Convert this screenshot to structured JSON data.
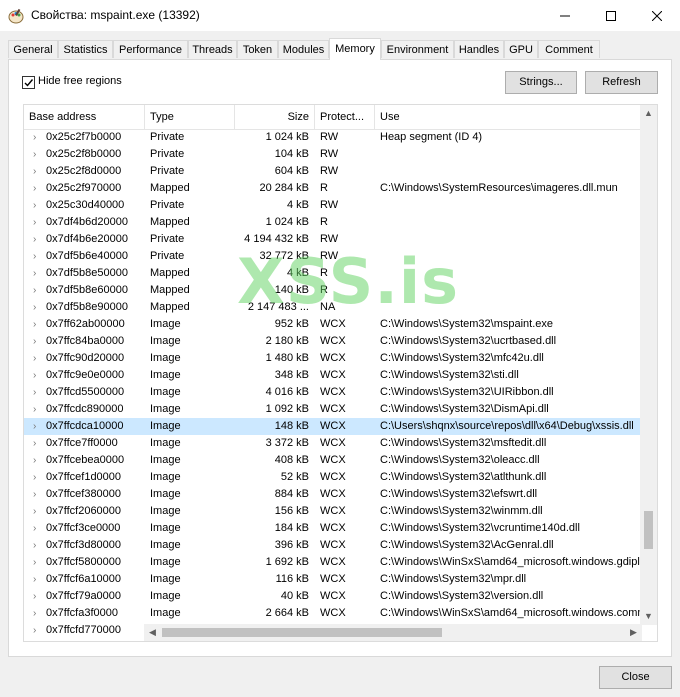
{
  "window": {
    "title": "Свойства: mspaint.exe (13392)",
    "minimize_glyph": "–",
    "maximize_glyph": "☐",
    "close_glyph": "✕"
  },
  "tabs": [
    {
      "label": "General"
    },
    {
      "label": "Statistics"
    },
    {
      "label": "Performance"
    },
    {
      "label": "Threads"
    },
    {
      "label": "Token"
    },
    {
      "label": "Modules"
    },
    {
      "label": "Memory",
      "active": true
    },
    {
      "label": "Environment"
    },
    {
      "label": "Handles"
    },
    {
      "label": "GPU"
    },
    {
      "label": "Comment"
    }
  ],
  "toolbar": {
    "hide_free_label": "Hide free regions",
    "hide_free_checked": true,
    "strings_label": "Strings...",
    "refresh_label": "Refresh"
  },
  "columns": [
    "Base address",
    "Type",
    "Size",
    "Protect...",
    "Use"
  ],
  "rows": [
    {
      "addr": "0x25c2f7b0000",
      "type": "Private",
      "size": "1 024 kB",
      "prot": "RW",
      "use": "Heap segment (ID 4)"
    },
    {
      "addr": "0x25c2f8b0000",
      "type": "Private",
      "size": "104 kB",
      "prot": "RW",
      "use": ""
    },
    {
      "addr": "0x25c2f8d0000",
      "type": "Private",
      "size": "604 kB",
      "prot": "RW",
      "use": ""
    },
    {
      "addr": "0x25c2f970000",
      "type": "Mapped",
      "size": "20 284 kB",
      "prot": "R",
      "use": "C:\\Windows\\SystemResources\\imageres.dll.mun"
    },
    {
      "addr": "0x25c30d40000",
      "type": "Private",
      "size": "4 kB",
      "prot": "RW",
      "use": ""
    },
    {
      "addr": "0x7df4b6d20000",
      "type": "Mapped",
      "size": "1 024 kB",
      "prot": "R",
      "use": ""
    },
    {
      "addr": "0x7df4b6e20000",
      "type": "Private",
      "size": "4 194 432 kB",
      "prot": "RW",
      "use": ""
    },
    {
      "addr": "0x7df5b6e40000",
      "type": "Private",
      "size": "32 772 kB",
      "prot": "RW",
      "use": ""
    },
    {
      "addr": "0x7df5b8e50000",
      "type": "Mapped",
      "size": "4 kB",
      "prot": "R",
      "use": ""
    },
    {
      "addr": "0x7df5b8e60000",
      "type": "Mapped",
      "size": "140 kB",
      "prot": "R",
      "use": ""
    },
    {
      "addr": "0x7df5b8e90000",
      "type": "Mapped",
      "size": "2 147 483 ...",
      "prot": "NA",
      "use": ""
    },
    {
      "addr": "0x7ff62ab00000",
      "type": "Image",
      "size": "952 kB",
      "prot": "WCX",
      "use": "C:\\Windows\\System32\\mspaint.exe"
    },
    {
      "addr": "0x7ffc84ba0000",
      "type": "Image",
      "size": "2 180 kB",
      "prot": "WCX",
      "use": "C:\\Windows\\System32\\ucrtbased.dll"
    },
    {
      "addr": "0x7ffc90d20000",
      "type": "Image",
      "size": "1 480 kB",
      "prot": "WCX",
      "use": "C:\\Windows\\System32\\mfc42u.dll"
    },
    {
      "addr": "0x7ffc9e0e0000",
      "type": "Image",
      "size": "348 kB",
      "prot": "WCX",
      "use": "C:\\Windows\\System32\\sti.dll"
    },
    {
      "addr": "0x7ffcd5500000",
      "type": "Image",
      "size": "4 016 kB",
      "prot": "WCX",
      "use": "C:\\Windows\\System32\\UIRibbon.dll"
    },
    {
      "addr": "0x7ffcdc890000",
      "type": "Image",
      "size": "1 092 kB",
      "prot": "WCX",
      "use": "C:\\Windows\\System32\\DismApi.dll"
    },
    {
      "addr": "0x7ffcdca10000",
      "type": "Image",
      "size": "148 kB",
      "prot": "WCX",
      "use": "C:\\Users\\shqnx\\source\\repos\\dll\\x64\\Debug\\xssis.dll",
      "selected": true
    },
    {
      "addr": "0x7ffce7ff0000",
      "type": "Image",
      "size": "3 372 kB",
      "prot": "WCX",
      "use": "C:\\Windows\\System32\\msftedit.dll"
    },
    {
      "addr": "0x7ffcebea0000",
      "type": "Image",
      "size": "408 kB",
      "prot": "WCX",
      "use": "C:\\Windows\\System32\\oleacc.dll"
    },
    {
      "addr": "0x7ffcef1d0000",
      "type": "Image",
      "size": "52 kB",
      "prot": "WCX",
      "use": "C:\\Windows\\System32\\atlthunk.dll"
    },
    {
      "addr": "0x7ffcef380000",
      "type": "Image",
      "size": "884 kB",
      "prot": "WCX",
      "use": "C:\\Windows\\System32\\efswrt.dll"
    },
    {
      "addr": "0x7ffcf2060000",
      "type": "Image",
      "size": "156 kB",
      "prot": "WCX",
      "use": "C:\\Windows\\System32\\winmm.dll"
    },
    {
      "addr": "0x7ffcf3ce0000",
      "type": "Image",
      "size": "184 kB",
      "prot": "WCX",
      "use": "C:\\Windows\\System32\\vcruntime140d.dll"
    },
    {
      "addr": "0x7ffcf3d80000",
      "type": "Image",
      "size": "396 kB",
      "prot": "WCX",
      "use": "C:\\Windows\\System32\\AcGenral.dll"
    },
    {
      "addr": "0x7ffcf5800000",
      "type": "Image",
      "size": "1 692 kB",
      "prot": "WCX",
      "use": "C:\\Windows\\WinSxS\\amd64_microsoft.windows.gdiplu"
    },
    {
      "addr": "0x7ffcf6a10000",
      "type": "Image",
      "size": "116 kB",
      "prot": "WCX",
      "use": "C:\\Windows\\System32\\mpr.dll"
    },
    {
      "addr": "0x7ffcf79a0000",
      "type": "Image",
      "size": "40 kB",
      "prot": "WCX",
      "use": "C:\\Windows\\System32\\version.dll"
    },
    {
      "addr": "0x7ffcfa3f0000",
      "type": "Image",
      "size": "2 664 kB",
      "prot": "WCX",
      "use": "C:\\Windows\\WinSxS\\amd64_microsoft.windows.comm"
    },
    {
      "addr": "0x7ffcfd770000",
      "type": "",
      "size": "",
      "prot": "",
      "use": ""
    }
  ],
  "watermark": "XSS.is",
  "footer": {
    "close_label": "Close"
  },
  "colors": {
    "selection": "#cce8ff",
    "watermark": "#5fd35f"
  }
}
